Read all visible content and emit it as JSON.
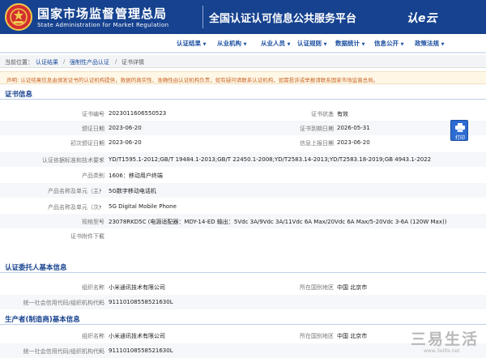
{
  "header": {
    "org_cn": "国家市场监督管理总局",
    "org_en": "State Administration  for  Market Regulation",
    "portal_title": "全国认证认可信息公共服务平台",
    "portal_logo_text": "认e云"
  },
  "nav": {
    "items": [
      {
        "label": "认证结果",
        "dropdown": true
      },
      {
        "label": "从业机构",
        "dropdown": true
      },
      {
        "label": "从业人员",
        "dropdown": true
      },
      {
        "label": "认证规则",
        "dropdown": true
      },
      {
        "label": "数据统计",
        "dropdown": true
      },
      {
        "label": "信息公开",
        "dropdown": true
      },
      {
        "label": "政策法规",
        "dropdown": true
      }
    ]
  },
  "breadcrumb": {
    "prefix": "当前位置：",
    "items": [
      "认证结果",
      "强制性产品认证",
      "证书详情"
    ],
    "separator": "/"
  },
  "notice": "声明: 认证结果信息由颁发证书的认证机构提供，数据的真实性、准确性由认证机构负责，如有疑问请联系认证机构，如需投诉或举报请联系国家市场监督总局。",
  "cert_section": {
    "title": "证书信息",
    "rows": [
      {
        "label": "证书编号",
        "value": "2023011606550523",
        "label2": "证书状态",
        "value2": "有效"
      },
      {
        "label": "颁证日期",
        "value": "2023-06-20",
        "label2": "证书到期日期",
        "value2": "2026-05-31"
      },
      {
        "label": "初次颁证日期",
        "value": "2023-06-20",
        "label2": "信息上报日期",
        "value2": "2023-06-20"
      },
      {
        "label": "认证依据标准和技术要求",
        "value": "YD/T1595.1-2012;GB/T 19484.1-2013;GB/T 22450.1-2008;YD/T2583.14-2013;YD/T2583.18-2019;GB 4943.1-2022"
      },
      {
        "label": "产品类别",
        "value": "1606：移动用户终端"
      },
      {
        "label": "产品名称及单元（主）",
        "value": "5G数字移动电话机"
      },
      {
        "label": "产品名称及单元（次）",
        "value": "5G Digital Mobile Phone"
      },
      {
        "label": "规格型号",
        "value": "23078RKD5C (电源适配器：MDY-14-ED 输出：5Vdc 3A/9Vdc 3A/11Vdc 6A Max/20Vdc 6A Max/5-20Vdc 3-6A (120W Max))"
      },
      {
        "label": "证书附件下载",
        "value": ""
      }
    ]
  },
  "client_section": {
    "title": "认证委托人基本信息",
    "rows": [
      {
        "label": "组织名称",
        "value": "小米通讯技术有限公司",
        "label2": "所在国别地区",
        "value2": "中国 北京市"
      },
      {
        "label": "统一社会信用代码/组织机构代码",
        "value": "91110108558521630L"
      }
    ]
  },
  "maker_section": {
    "title": "生产者(制造商)基本信息",
    "rows": [
      {
        "label": "组织名称",
        "value": "小米通讯技术有限公司",
        "label2": "所在国别地区",
        "value2": "中国 北京市"
      },
      {
        "label": "统一社会信用代码/组织机构代码",
        "value": "91110108558521630L"
      }
    ]
  },
  "print": {
    "label": "打印",
    "icon": "printer-icon"
  },
  "watermark": {
    "big": "三易生活",
    "small": "www.3elife.net"
  },
  "colors": {
    "header_bg": "#16428f",
    "nav_text": "#1a4ea0",
    "notice_text": "#c8662a",
    "section_title": "#16428f"
  }
}
